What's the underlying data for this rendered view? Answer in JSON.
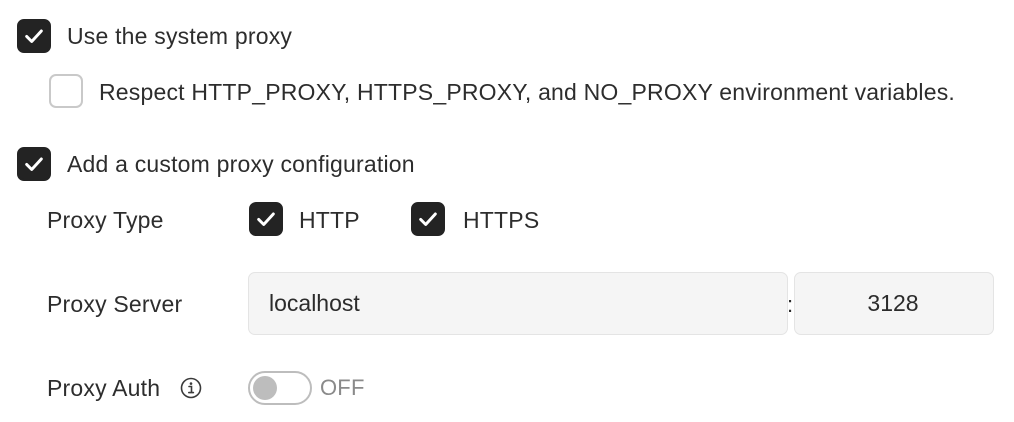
{
  "system_proxy": {
    "checked": true,
    "label": "Use the system proxy",
    "env_vars": {
      "checked": false,
      "label": "Respect HTTP_PROXY, HTTPS_PROXY, and NO_PROXY environment variables."
    }
  },
  "custom_proxy": {
    "checked": true,
    "label": "Add a custom proxy configuration",
    "proxy_type": {
      "label": "Proxy Type",
      "options": [
        {
          "label": "HTTP",
          "checked": true
        },
        {
          "label": "HTTPS",
          "checked": true
        }
      ]
    },
    "proxy_server": {
      "label": "Proxy Server",
      "host": "localhost",
      "separator": ":",
      "port": "3128"
    },
    "proxy_auth": {
      "label": "Proxy Auth",
      "info_icon": "info-circle-icon",
      "toggle_on": false,
      "toggle_state": "OFF"
    }
  },
  "colors": {
    "checkbox_checked": "#232323",
    "checkbox_unchecked_border": "#c9c9c9",
    "field_bg": "#f5f5f5",
    "toggle_off": "#bdbdbd"
  }
}
